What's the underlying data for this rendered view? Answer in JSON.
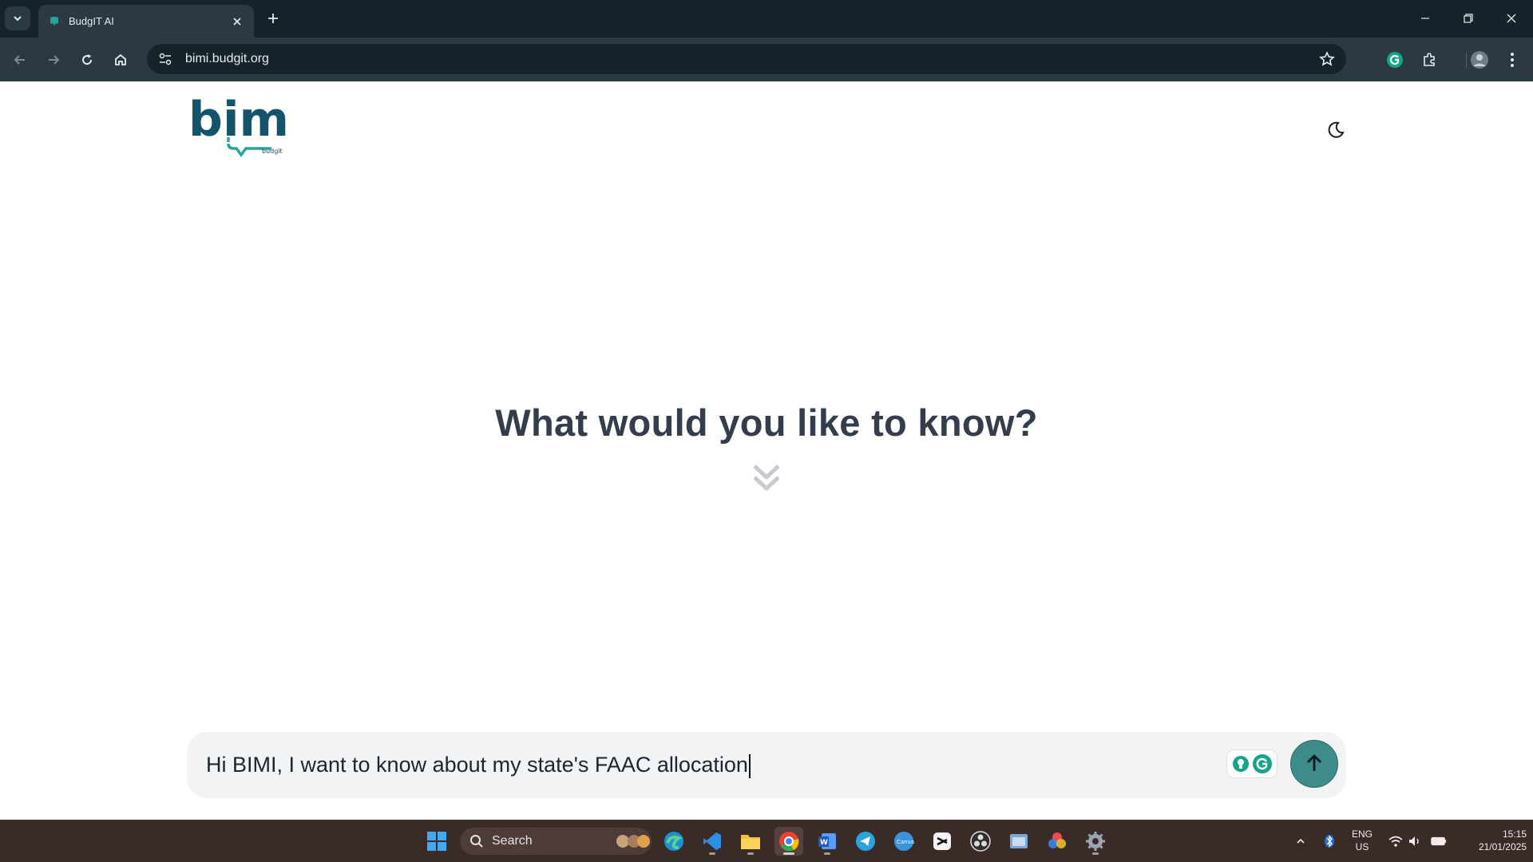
{
  "browser": {
    "tab_title": "BudgIT AI",
    "url": "bimi.budgit.org"
  },
  "page": {
    "logo_text": "bimi",
    "logo_subtext": "budgit",
    "heading": "What would you like to know?",
    "prompt_text": "Hi BIMI, I want to know about my state's FAAC allocation",
    "accent_color": "#3d8c8a"
  },
  "taskbar": {
    "search_label": "Search",
    "language_top": "ENG",
    "language_bottom": "US",
    "time": "15:15",
    "date": "21/01/2025",
    "apps": [
      "start-icon",
      "edge-icon",
      "vscode-icon",
      "file-explorer-icon",
      "chrome-icon",
      "word-icon",
      "telegram-icon",
      "canva-icon",
      "capcut-icon",
      "obs-icon",
      "screenshot-icon",
      "color-picker-icon",
      "settings-icon"
    ]
  }
}
